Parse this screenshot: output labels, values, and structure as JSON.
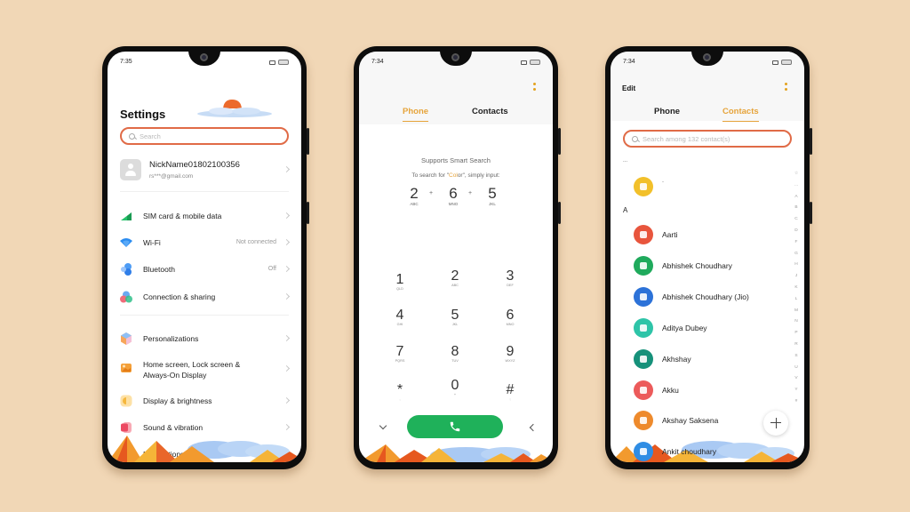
{
  "colors": {
    "background": "#f1d7b6",
    "accent": "#e6a43b",
    "search_border": "#e06b47",
    "call_green": "#1fb15a"
  },
  "settings_screen": {
    "status_time": "7:35",
    "title": "Settings",
    "search_placeholder": "Search",
    "account": {
      "name": "NickName01802100356",
      "email": "rs***@gmail.com"
    },
    "group1": [
      {
        "icon": "sim-card-icon",
        "label": "SIM card & mobile data",
        "value": ""
      },
      {
        "icon": "wifi-icon",
        "label": "Wi-Fi",
        "value": "Not connected"
      },
      {
        "icon": "bluetooth-icon",
        "label": "Bluetooth",
        "value": "Off"
      },
      {
        "icon": "connection-sharing-icon",
        "label": "Connection & sharing",
        "value": ""
      }
    ],
    "group2": [
      {
        "icon": "personalizations-icon",
        "label": "Personalizations"
      },
      {
        "icon": "home-screen-icon",
        "label_line1": "Home screen, Lock screen &",
        "label_line2": "Always-On Display"
      },
      {
        "icon": "display-brightness-icon",
        "label": "Display & brightness"
      },
      {
        "icon": "sound-vibration-icon",
        "label": "Sound & vibration"
      },
      {
        "icon": "notifications-icon",
        "label": "Notifications & status bar"
      }
    ]
  },
  "dialer_screen": {
    "status_time": "7:34",
    "tabs": [
      {
        "label": "Phone",
        "active": true
      },
      {
        "label": "Contacts",
        "active": false
      }
    ],
    "smart_search_title": "Supports Smart Search",
    "hint_prefix": "To search for \"",
    "hint_highlight": "Col",
    "hint_rest": "or",
    "hint_suffix": "\", simply input:",
    "combo": [
      {
        "digit": "2",
        "letters": "ABC"
      },
      {
        "digit": "6",
        "letters": "MNO"
      },
      {
        "digit": "5",
        "letters": "JKL"
      }
    ],
    "combo_plus": "+",
    "keypad": [
      {
        "digit": "1",
        "letters": "QLD"
      },
      {
        "digit": "2",
        "letters": "ABC"
      },
      {
        "digit": "3",
        "letters": "DEF"
      },
      {
        "digit": "4",
        "letters": "GHI"
      },
      {
        "digit": "5",
        "letters": "JKL"
      },
      {
        "digit": "6",
        "letters": "MNO"
      },
      {
        "digit": "7",
        "letters": "PQRS"
      },
      {
        "digit": "8",
        "letters": "TUV"
      },
      {
        "digit": "9",
        "letters": "WXYZ"
      },
      {
        "digit": "*",
        "letters": ","
      },
      {
        "digit": "0",
        "letters": "+"
      },
      {
        "digit": "#",
        "letters": ";"
      }
    ]
  },
  "contacts_screen": {
    "status_time": "7:34",
    "edit_label": "Edit",
    "tabs": [
      {
        "label": "Phone",
        "active": false
      },
      {
        "label": "Contacts",
        "active": true
      }
    ],
    "search_placeholder": "Search among 132 contact(s)",
    "sections": [
      {
        "header": "...",
        "contacts": [
          {
            "name": "-",
            "color": "#f2c02a"
          }
        ]
      },
      {
        "header": "A",
        "contacts": [
          {
            "name": "Aarti",
            "color": "#e8553d"
          },
          {
            "name": "Abhishek Choudhary",
            "color": "#1faa5c"
          },
          {
            "name": "Abhishek Choudhary (Jio)",
            "color": "#2c72d8"
          },
          {
            "name": "Aditya Dubey",
            "color": "#2ec4a8"
          },
          {
            "name": "Akhshay",
            "color": "#16917a"
          },
          {
            "name": "Akku",
            "color": "#ec5a5a"
          },
          {
            "name": "Akshay Saksena",
            "color": "#ee8a2c"
          },
          {
            "name": "Ankit choudhary",
            "color": "#2f8de4"
          }
        ]
      }
    ],
    "index_letters": [
      "☆",
      "...",
      "A",
      "B",
      "C",
      "D",
      "F",
      "G",
      "H",
      "J",
      "K",
      "L",
      "M",
      "N",
      "P",
      "R",
      "S",
      "U",
      "V",
      "Y",
      "#"
    ]
  }
}
